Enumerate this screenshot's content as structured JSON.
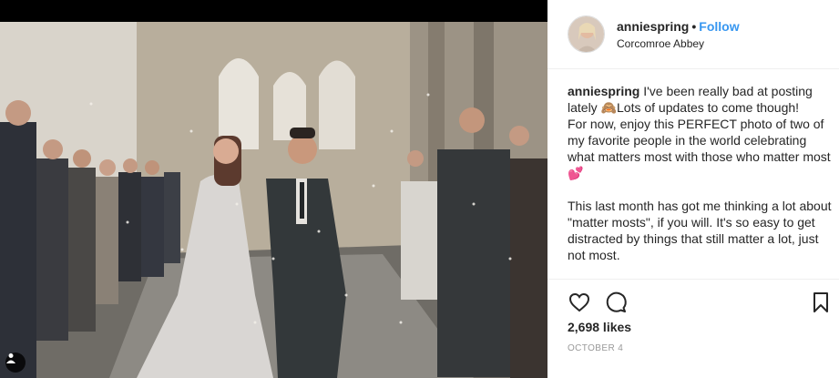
{
  "post": {
    "username": "anniespring",
    "separator": "•",
    "follow_label": "Follow",
    "location": "Corcomroe Abbey",
    "caption_user": "anniespring",
    "caption_text": " I've been really bad at posting lately 🙈Lots of updates to come though!\nFor now, enjoy this PERFECT photo of two of my favorite people in the world celebrating what matters most with those who matter most 💕\n\nThis last month has got me thinking a lot about \"matter mosts\", if you will. It's so easy to get distracted by things that still matter a lot, just not most.",
    "likes": "2,698 likes",
    "date": "OCTOBER 4"
  },
  "icons": {
    "like": "heart-icon",
    "comment": "comment-icon",
    "save": "bookmark-icon",
    "tag": "user-tag-icon"
  },
  "colors": {
    "follow": "#3897f0",
    "text": "#262626",
    "muted": "#999999",
    "divider": "#efefef"
  }
}
